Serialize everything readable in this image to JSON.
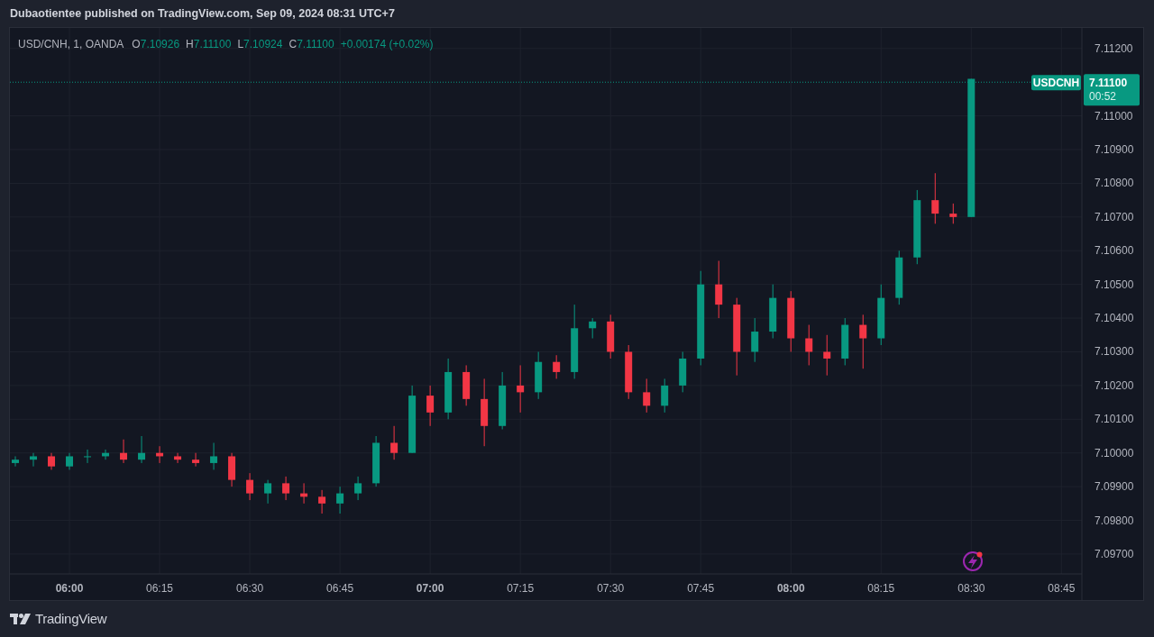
{
  "header": {
    "text": "Dubaotientee published on TradingView.com, Sep 09, 2024 08:31 UTC+7"
  },
  "legend": {
    "symbol": "USD/CNH, 1, OANDA",
    "fields": [
      {
        "label": "O",
        "value": "7.10926"
      },
      {
        "label": "H",
        "value": "7.11100"
      },
      {
        "label": "L",
        "value": "7.10924"
      },
      {
        "label": "C",
        "value": "7.11100"
      }
    ],
    "change": "+0.00174 (+0.02%)"
  },
  "last_price": {
    "symbol": "USDCNH",
    "price": "7.11100",
    "countdown": "00:52"
  },
  "chart_data": {
    "type": "candlestick",
    "x": [
      351,
      354,
      357,
      360,
      363,
      366,
      369,
      372,
      375,
      378,
      381,
      384,
      387,
      390,
      393,
      396,
      399,
      402,
      405,
      408,
      411,
      414,
      417,
      420,
      423,
      426,
      429,
      432,
      435,
      438,
      441,
      444,
      447,
      450,
      453,
      456,
      459,
      462,
      465,
      468,
      471,
      474,
      477,
      480,
      483,
      486,
      489,
      492,
      495,
      498,
      501,
      504,
      507,
      510
    ],
    "ohlc": [
      [
        7.0997,
        7.0999,
        7.0996,
        7.0998
      ],
      [
        7.0998,
        7.1,
        7.0996,
        7.0999
      ],
      [
        7.0999,
        7.1,
        7.0995,
        7.0996
      ],
      [
        7.0996,
        7.1,
        7.0995,
        7.0999
      ],
      [
        7.0999,
        7.1001,
        7.0997,
        7.0999
      ],
      [
        7.0999,
        7.1001,
        7.0998,
        7.1
      ],
      [
        7.1,
        7.1004,
        7.0997,
        7.0998
      ],
      [
        7.0998,
        7.1005,
        7.0997,
        7.1
      ],
      [
        7.1,
        7.1002,
        7.0997,
        7.0999
      ],
      [
        7.0999,
        7.1,
        7.0997,
        7.0998
      ],
      [
        7.0998,
        7.1,
        7.0996,
        7.0997
      ],
      [
        7.0997,
        7.1003,
        7.0995,
        7.0999
      ],
      [
        7.0999,
        7.1,
        7.099,
        7.0992
      ],
      [
        7.0992,
        7.0994,
        7.0986,
        7.0988
      ],
      [
        7.0988,
        7.0992,
        7.0985,
        7.0991
      ],
      [
        7.0991,
        7.0993,
        7.0986,
        7.0988
      ],
      [
        7.0988,
        7.0991,
        7.0985,
        7.0987
      ],
      [
        7.0987,
        7.0989,
        7.0982,
        7.0985
      ],
      [
        7.0985,
        7.099,
        7.0982,
        7.0988
      ],
      [
        7.0988,
        7.0993,
        7.0986,
        7.0991
      ],
      [
        7.0991,
        7.1005,
        7.099,
        7.1003
      ],
      [
        7.1003,
        7.1008,
        7.0998,
        7.1
      ],
      [
        7.1,
        7.102,
        7.1,
        7.1017
      ],
      [
        7.1017,
        7.102,
        7.1008,
        7.1012
      ],
      [
        7.1012,
        7.1028,
        7.101,
        7.1024
      ],
      [
        7.1024,
        7.1026,
        7.1014,
        7.1016
      ],
      [
        7.1016,
        7.1022,
        7.1002,
        7.1008
      ],
      [
        7.1008,
        7.1024,
        7.1007,
        7.102
      ],
      [
        7.102,
        7.1026,
        7.1012,
        7.1018
      ],
      [
        7.1018,
        7.103,
        7.1016,
        7.1027
      ],
      [
        7.1027,
        7.1029,
        7.1022,
        7.1024
      ],
      [
        7.1024,
        7.1044,
        7.1022,
        7.1037
      ],
      [
        7.1037,
        7.104,
        7.1034,
        7.1039
      ],
      [
        7.1039,
        7.1041,
        7.1028,
        7.103
      ],
      [
        7.103,
        7.1032,
        7.1016,
        7.1018
      ],
      [
        7.1018,
        7.1022,
        7.1012,
        7.1014
      ],
      [
        7.1014,
        7.1022,
        7.1012,
        7.102
      ],
      [
        7.102,
        7.103,
        7.1018,
        7.1028
      ],
      [
        7.1028,
        7.1054,
        7.1026,
        7.105
      ],
      [
        7.105,
        7.1057,
        7.104,
        7.1044
      ],
      [
        7.1044,
        7.1046,
        7.1023,
        7.103
      ],
      [
        7.103,
        7.104,
        7.1027,
        7.1036
      ],
      [
        7.1036,
        7.105,
        7.1034,
        7.1046
      ],
      [
        7.1046,
        7.1048,
        7.103,
        7.1034
      ],
      [
        7.1034,
        7.1038,
        7.1026,
        7.103
      ],
      [
        7.103,
        7.1035,
        7.1023,
        7.1028
      ],
      [
        7.1028,
        7.104,
        7.1026,
        7.1038
      ],
      [
        7.1038,
        7.1041,
        7.1025,
        7.1034
      ],
      [
        7.1034,
        7.105,
        7.1032,
        7.1046
      ],
      [
        7.1046,
        7.106,
        7.1044,
        7.1058
      ],
      [
        7.1058,
        7.1078,
        7.1056,
        7.1075
      ],
      [
        7.1075,
        7.1083,
        7.1068,
        7.1071
      ],
      [
        7.1071,
        7.1074,
        7.1068,
        7.107
      ],
      [
        7.107,
        7.1111,
        7.107,
        7.1111
      ]
    ],
    "xlim": [
      350.1,
      528.4
    ],
    "ylim": [
      7.09641,
      7.11261
    ],
    "grid": true,
    "ref_lines": [
      {
        "axis": "y",
        "value": 7.111
      }
    ],
    "yticks": [
      {
        "value": 7.097,
        "label": "7.09700"
      },
      {
        "value": 7.098,
        "label": "7.09800"
      },
      {
        "value": 7.099,
        "label": "7.09900"
      },
      {
        "value": 7.1,
        "label": "7.10000"
      },
      {
        "value": 7.101,
        "label": "7.10100"
      },
      {
        "value": 7.102,
        "label": "7.10200"
      },
      {
        "value": 7.103,
        "label": "7.10300"
      },
      {
        "value": 7.104,
        "label": "7.10400"
      },
      {
        "value": 7.105,
        "label": "7.10500"
      },
      {
        "value": 7.106,
        "label": "7.10600"
      },
      {
        "value": 7.107,
        "label": "7.10700"
      },
      {
        "value": 7.108,
        "label": "7.10800"
      },
      {
        "value": 7.109,
        "label": "7.10900"
      },
      {
        "value": 7.11,
        "label": "7.11000"
      },
      {
        "value": 7.112,
        "label": "7.11200"
      }
    ],
    "xticks": [
      {
        "value": 360,
        "label": "06:00"
      },
      {
        "value": 375,
        "label": "06:15"
      },
      {
        "value": 390,
        "label": "06:30"
      },
      {
        "value": 405,
        "label": "06:45"
      },
      {
        "value": 420,
        "label": "07:00"
      },
      {
        "value": 435,
        "label": "07:15"
      },
      {
        "value": 450,
        "label": "07:30"
      },
      {
        "value": 465,
        "label": "07:45"
      },
      {
        "value": 480,
        "label": "08:00"
      },
      {
        "value": 495,
        "label": "08:15"
      },
      {
        "value": 510,
        "label": "08:30"
      },
      {
        "value": 525,
        "label": "08:45"
      }
    ]
  },
  "footer": {
    "brand": "TradingView"
  }
}
